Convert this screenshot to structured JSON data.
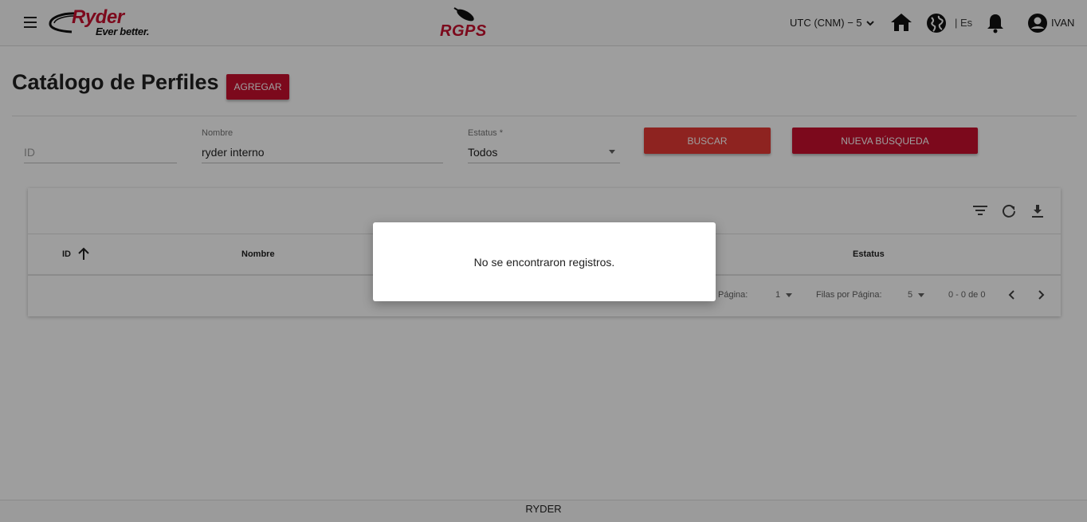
{
  "header": {
    "brand": {
      "name": "Ryder",
      "tagline": "Ever better."
    },
    "app_logo": "RGPS",
    "timezone": "UTC (CNM) − 5",
    "language": "| Es",
    "user": "IVAN"
  },
  "page": {
    "title": "Catálogo de Perfiles",
    "add_label": "AGREGAR"
  },
  "filters": {
    "id": {
      "placeholder": "ID",
      "value": ""
    },
    "nombre": {
      "label": "Nombre",
      "value": "ryder interno"
    },
    "estatus": {
      "label": "Estatus *",
      "value": "Todos"
    },
    "search_label": "BUSCAR",
    "new_search_label": "NUEVA BÚSQUEDA"
  },
  "table": {
    "columns": [
      "ID",
      "Nombre",
      "Estatus"
    ],
    "pagination": {
      "page_label": "Página:",
      "page": "1",
      "rows_label": "Filas por Página:",
      "rows": "5",
      "range": "0 - 0 de 0"
    }
  },
  "dialog": {
    "message": "No se encontraron registros."
  },
  "footer": {
    "text": "RYDER"
  },
  "colors": {
    "brand_red": "#c8102e",
    "search_red": "#e53935"
  }
}
